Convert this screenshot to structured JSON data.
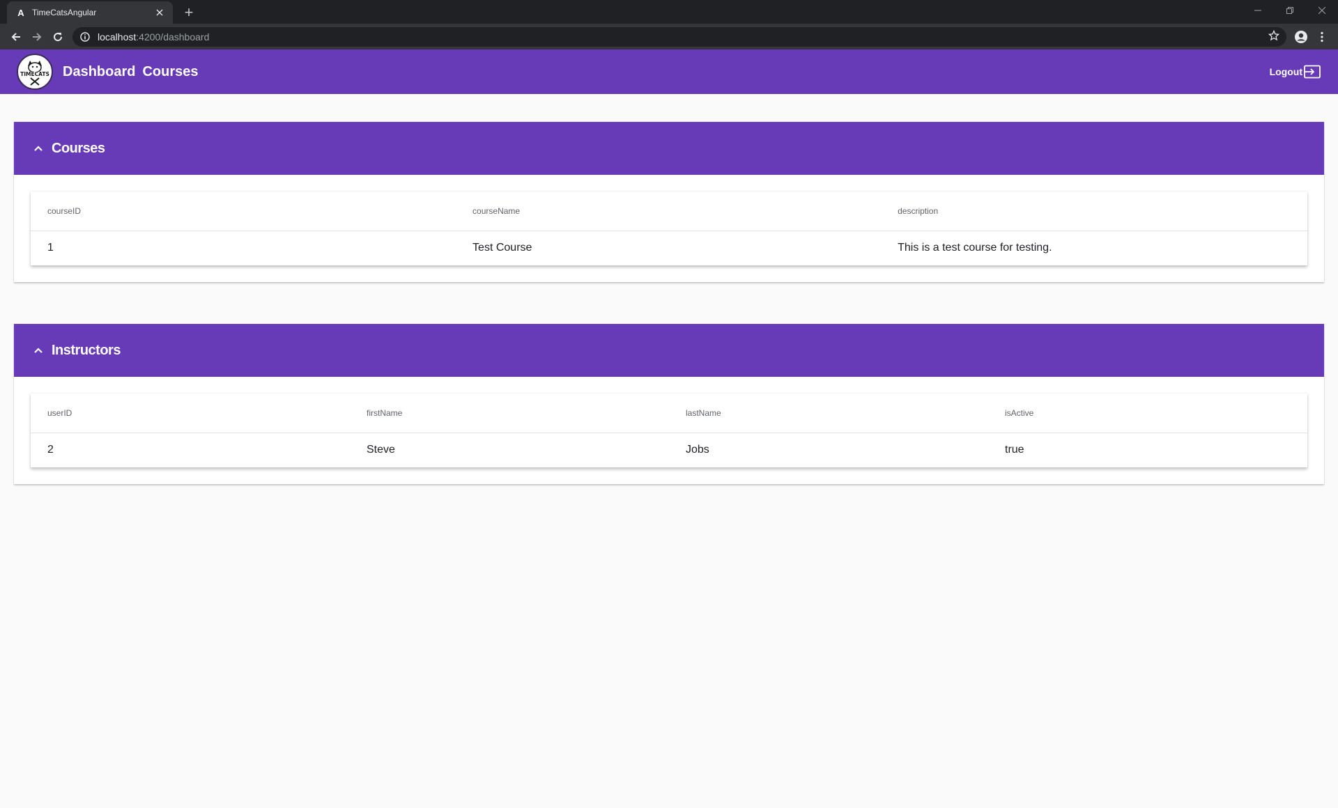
{
  "browser": {
    "tab_title": "TimeCatsAngular",
    "tab_favicon": "A",
    "new_tab_label": "+",
    "url_host": "localhost",
    "url_rest": ":4200/dashboard"
  },
  "header": {
    "logo_text": "TIMECATS",
    "nav": [
      "Dashboard",
      "Courses"
    ],
    "logout_label": "Logout",
    "brand_color": "#673ab7"
  },
  "courses_panel": {
    "title": "Courses",
    "columns": [
      "courseID",
      "courseName",
      "description"
    ],
    "rows": [
      [
        "1",
        "Test Course",
        "This is a test course for testing."
      ]
    ]
  },
  "instructors_panel": {
    "title": "Instructors",
    "columns": [
      "userID",
      "firstName",
      "lastName",
      "isActive"
    ],
    "rows": [
      [
        "2",
        "Steve",
        "Jobs",
        "true"
      ]
    ]
  }
}
